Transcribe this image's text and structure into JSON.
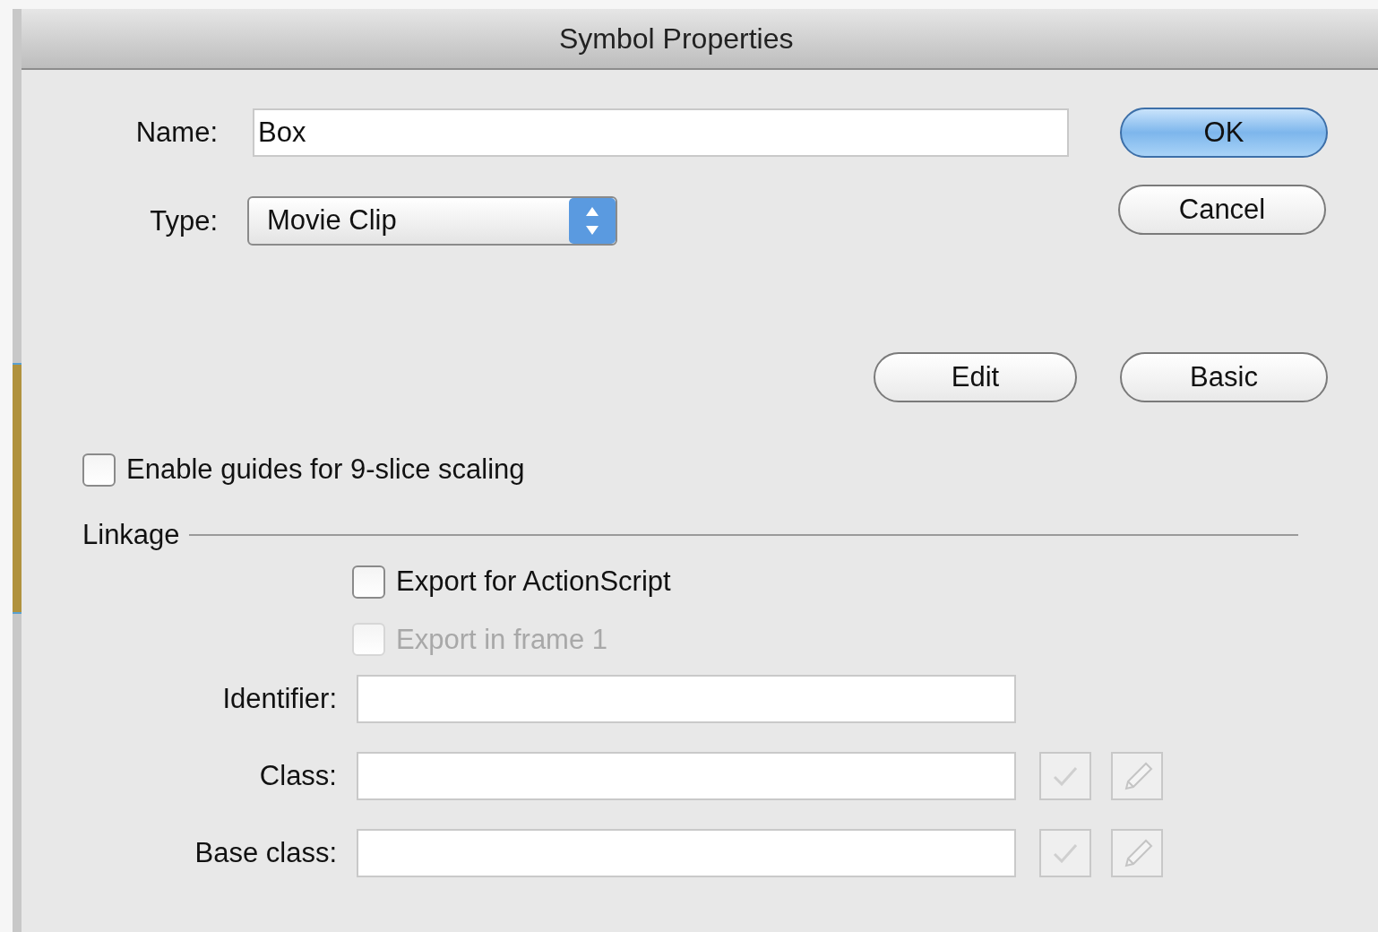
{
  "window": {
    "title": "Symbol Properties"
  },
  "name_field": {
    "label": "Name:",
    "value": "Box"
  },
  "type_field": {
    "label": "Type:",
    "value": "Movie Clip"
  },
  "dialog_buttons": [
    {
      "label": "OK",
      "default": true
    },
    {
      "label": "Cancel",
      "default": false
    }
  ],
  "mode_buttons": [
    {
      "label": "Edit"
    },
    {
      "label": "Basic"
    }
  ],
  "nine_slice": {
    "label": "Enable guides for 9-slice scaling",
    "checked": false
  },
  "linkage": {
    "title": "Linkage",
    "options": [
      {
        "label": "Export for ActionScript",
        "checked": false,
        "disabled": false
      },
      {
        "label": "Export in frame 1",
        "checked": false,
        "disabled": true
      }
    ],
    "fields": [
      {
        "label": "Identifier:",
        "kind": "plain"
      },
      {
        "label": "Class:",
        "kind": "tools"
      },
      {
        "label": "Base class:",
        "kind": "tools"
      }
    ]
  }
}
